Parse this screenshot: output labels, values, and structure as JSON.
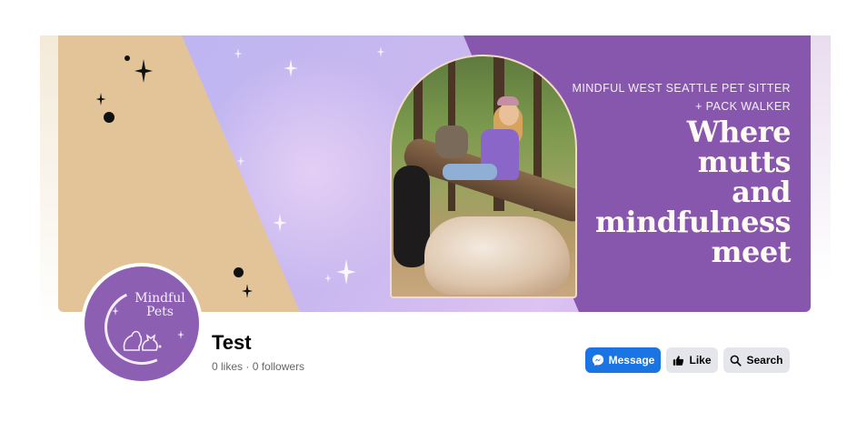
{
  "cover": {
    "tagline_small": "MINDFUL WEST SEATTLE PET SITTER + PACK WALKER",
    "tagline_big_lines": [
      "Where",
      "mutts",
      "and",
      "mindfulness",
      "meet"
    ]
  },
  "avatar": {
    "logo_text_line1": "Mindful",
    "logo_text_line2": "Pets"
  },
  "profile": {
    "name": "Test",
    "likes": "0 likes",
    "separator": "·",
    "followers": "0 followers"
  },
  "actions": {
    "message_label": "Message",
    "like_label": "Like",
    "search_label": "Search"
  },
  "icons": {
    "message": "messenger-icon",
    "like": "thumbs-up-icon",
    "search": "search-icon"
  },
  "colors": {
    "accent": "#1b74e4",
    "button_secondary": "#e4e6eb",
    "brand_purple": "#8757ad",
    "tan": "#e3c499"
  }
}
